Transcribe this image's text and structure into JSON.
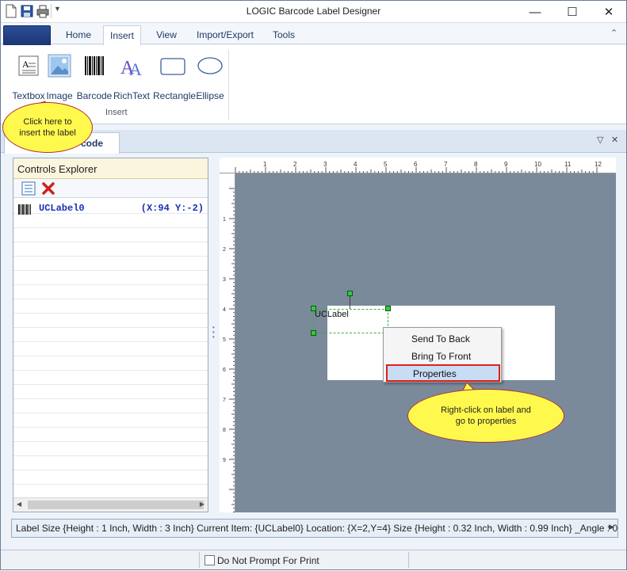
{
  "window": {
    "title": "LOGIC Barcode Label Designer",
    "controls": [
      "minimize-icon",
      "maximize-icon",
      "close-icon"
    ],
    "control_glyphs": [
      "—",
      "☐",
      "✕"
    ]
  },
  "quick_access": [
    "new-document-icon",
    "save-icon",
    "print-icon",
    "customize-dropdown-icon"
  ],
  "ribbon": {
    "tabs": [
      "Home",
      "Insert",
      "View",
      "Import/Export",
      "Tools"
    ],
    "active_tab": "Insert",
    "collapse_glyph": "⌃",
    "group_label": "Insert",
    "buttons": [
      {
        "label": "Textbox",
        "icon": "textbox-icon"
      },
      {
        "label": "Image",
        "icon": "image-icon"
      },
      {
        "label": "Barcode",
        "icon": "barcode-icon"
      },
      {
        "label": "RichText",
        "icon": "richtext-icon"
      },
      {
        "label": "Rectangle",
        "icon": "rectangle-icon"
      },
      {
        "label": "Ellipse",
        "icon": "ellipse-icon"
      }
    ]
  },
  "document_tab": {
    "label": "code",
    "dropdown_glyph": "▽",
    "close_glyph": "✕"
  },
  "controls_explorer": {
    "title": "Controls Explorer",
    "tools": [
      "properties-list-icon",
      "delete-icon"
    ],
    "items": [
      {
        "name": "UCLabel0",
        "coords": "(X:94 Y:-2)",
        "icon": "barcode-item-icon"
      }
    ],
    "scroll_left": "◀",
    "scroll_right": "▶"
  },
  "canvas": {
    "ruler_h": [
      "1",
      "2",
      "3",
      "4",
      "5",
      "6",
      "7",
      "8",
      "9",
      "10",
      "11",
      "12"
    ],
    "ruler_v": [
      "1",
      "2",
      "3",
      "4",
      "5",
      "6",
      "7",
      "8",
      "9"
    ],
    "label_text": "UCLabel"
  },
  "context_menu": {
    "items": [
      "Send To Back",
      "Bring To Front",
      "Properties"
    ],
    "highlighted": "Properties"
  },
  "callouts": {
    "insert": "Click here to insert the label",
    "properties": "Right-click on label and go to properties"
  },
  "status_bar": {
    "text": "Label Size {Height : 1 Inch, Width : 3 Inch}  Current Item: {UCLabel0} Location: {X=2,Y=4} Size {Height : 0.32 Inch, Width : 0.99 Inch} _Angle : 0"
  },
  "bottom_bar": {
    "print_prompt": "Do Not Prompt For Print",
    "checked": false
  },
  "colors": {
    "accent": "#1f3a66",
    "workspace": "#7a8a9a",
    "callout_fill": "#fff94d",
    "highlight_border": "#e02020",
    "selection_handle": "#2ecc40"
  }
}
